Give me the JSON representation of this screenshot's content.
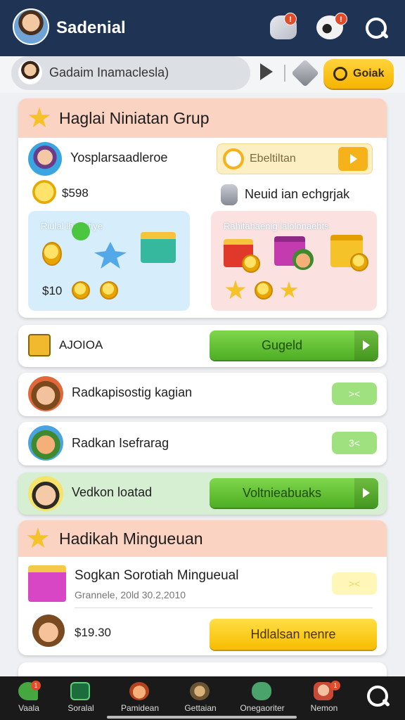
{
  "header": {
    "title": "Sadenial",
    "notif_1": "!",
    "notif_2": "!"
  },
  "search": {
    "text": "Gadaim Inamaclesla)",
    "action_label": "Goiak"
  },
  "group_card": {
    "title": "Haglai Niniatan Grup",
    "item_name": "Yosplarsaadleroe",
    "item_price": "$598",
    "timer_label": "Ebeltiltan",
    "info_text": "Neuid ian echgrjak",
    "panel_blue_label": "Riulal   lhonotiye",
    "panel_blue_price": "$10",
    "panel_pink_label": "Rahitahaenig  lalolonaehts"
  },
  "action_row": {
    "label": "AJOIOA",
    "button": "Gugeld"
  },
  "list_rows": [
    {
      "name": "Radkapisostig kagian",
      "badge": "><"
    },
    {
      "name": "Radkan Isefrarag",
      "badge": "3<"
    }
  ],
  "volunteer_row": {
    "name": "Vedkon loatad",
    "button": "Voltnieabuaks"
  },
  "weekly_card": {
    "title": "Hadikah Mingueuan",
    "item_title": "Sogkan Sorotiah Mingueual",
    "item_sub": "Grannele, 20ld 30.2,2010",
    "badge": "><",
    "price": "$19.30",
    "button": "Hdlalsan nenre"
  },
  "bottom_nav": [
    {
      "label": "Vaala",
      "icon": "leaf-icon",
      "badge": "1"
    },
    {
      "label": "Soralal",
      "icon": "board-icon"
    },
    {
      "label": "Pamidean",
      "icon": "face-icon"
    },
    {
      "label": "Gettaian",
      "icon": "compass-icon"
    },
    {
      "label": "Onegaoriter",
      "icon": "cloud-icon"
    },
    {
      "label": "Nemon",
      "icon": "person-icon",
      "badge": "1"
    }
  ],
  "colors": {
    "topbar": "#1f3355",
    "accent_gold": "#f6b400",
    "accent_green": "#4eae24",
    "header_peach": "#fbd3c2"
  }
}
